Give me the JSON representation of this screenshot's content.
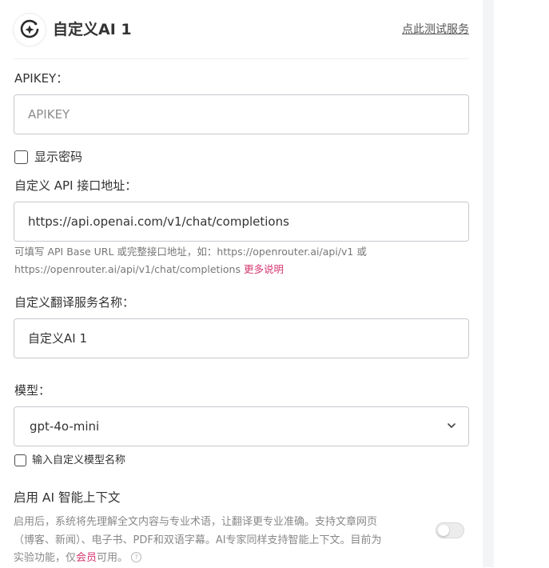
{
  "header": {
    "title": "自定义AI 1",
    "test_link": "点此测试服务",
    "logo_icon": "ai-sparkle-icon"
  },
  "apikey": {
    "label": "APIKEY：",
    "placeholder": "APIKEY",
    "value": ""
  },
  "show_password": {
    "label": "显示密码",
    "checked": false
  },
  "api_endpoint": {
    "label": "自定义 API 接口地址：",
    "value": "https://api.openai.com/v1/chat/completions",
    "help_line1": "可填写 API Base URL 或完整接口地址，如：https://openrouter.ai/api/v1 或",
    "help_line2": "https://openrouter.ai/api/v1/chat/completions",
    "help_link": "更多说明"
  },
  "service_name": {
    "label": "自定义翻译服务名称：",
    "value": "自定义AI 1"
  },
  "model": {
    "label": "模型：",
    "selected": "gpt-4o-mini",
    "dropdown_icon": "chevron-down-icon"
  },
  "custom_model": {
    "label": "输入自定义模型名称",
    "checked": false
  },
  "smart_context": {
    "title": "启用 AI 智能上下文",
    "desc_line1": "启用后，系统将先理解全文内容与专业术语，让翻译更专业准确。支持文章网页",
    "desc_line2": "（博客、新闻）、电子书、PDF和双语字幕。AI专家同样支持智能上下文。目前为",
    "desc_line3_prefix": "实验功能，仅",
    "desc_member": "会员",
    "desc_line3_suffix": "可用。",
    "help_icon": "question-circle-icon",
    "enabled": false
  },
  "colors": {
    "accent": "#d6366f",
    "border": "#c6c9ce",
    "panel_bg": "#f3f4f6"
  }
}
